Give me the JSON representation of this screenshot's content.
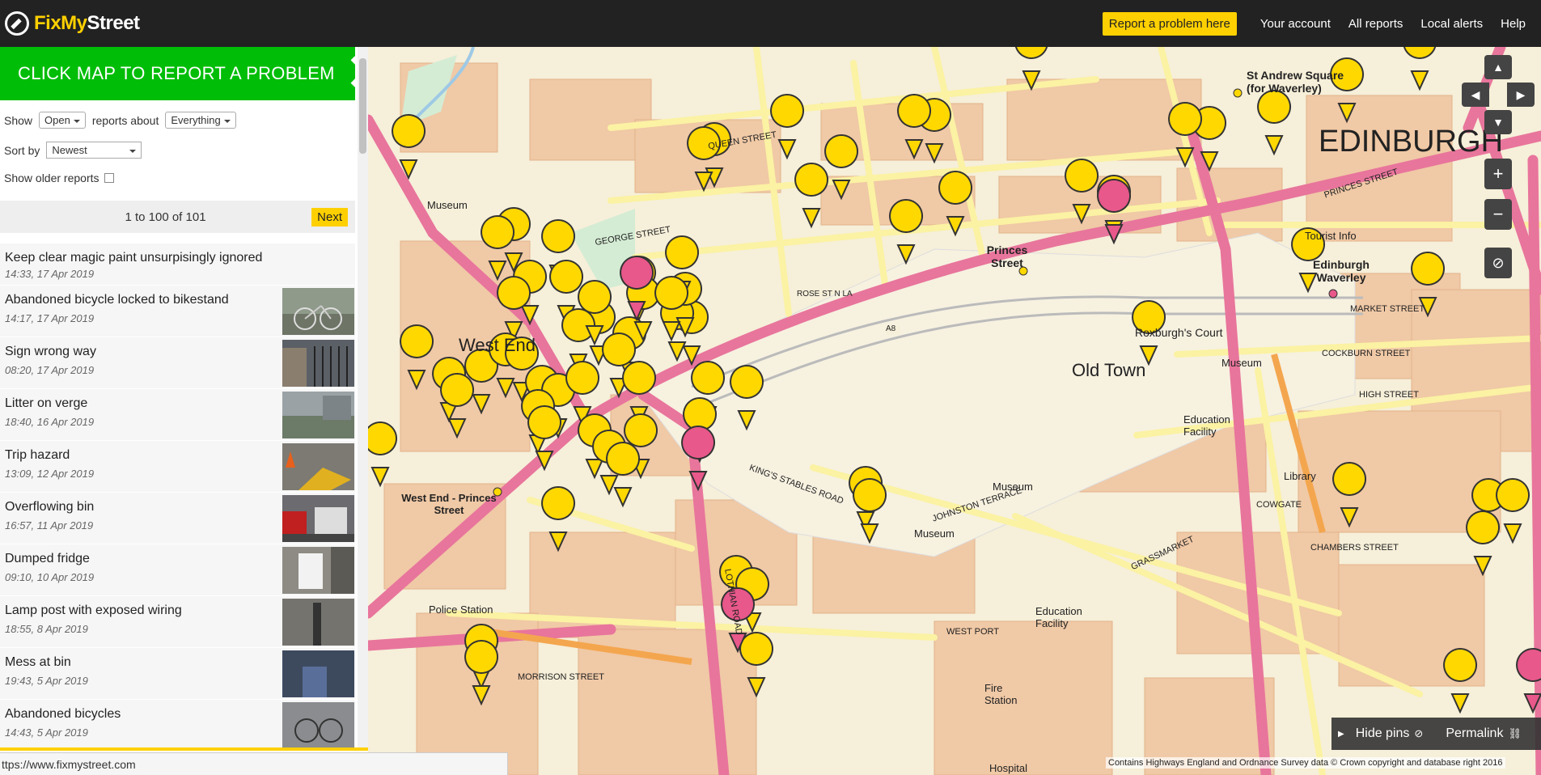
{
  "header": {
    "logo_part1": "FixMy",
    "logo_part2": "Street",
    "report_button": "Report a problem here",
    "nav": [
      "Your account",
      "All reports",
      "Local alerts",
      "Help"
    ]
  },
  "sidebar": {
    "cta": "CLICK MAP TO REPORT A PROBLEM",
    "show_label": "Show",
    "status_value": "Open",
    "reports_about_label": "reports about",
    "category_value": "Everything",
    "sort_label": "Sort by",
    "sort_value": "Newest",
    "older_label": "Show older reports",
    "pager_text": "1 to 100 of 101",
    "next_label": "Next",
    "reports": [
      {
        "title": "Keep clear magic paint unsurpisingly ignored",
        "meta": "14:33, 17 Apr 2019",
        "has_photo": false
      },
      {
        "title": "Abandoned bicycle locked to bikestand",
        "meta": "14:17, 17 Apr 2019",
        "has_photo": true
      },
      {
        "title": "Sign wrong way",
        "meta": "08:20, 17 Apr 2019",
        "has_photo": true
      },
      {
        "title": "Litter on verge",
        "meta": "18:40, 16 Apr 2019",
        "has_photo": true
      },
      {
        "title": "Trip hazard",
        "meta": "13:09, 12 Apr 2019",
        "has_photo": true
      },
      {
        "title": "Overflowing bin",
        "meta": "16:57, 11 Apr 2019",
        "has_photo": true
      },
      {
        "title": "Dumped fridge",
        "meta": "09:10, 10 Apr 2019",
        "has_photo": true
      },
      {
        "title": "Lamp post with exposed wiring",
        "meta": "18:55, 8 Apr 2019",
        "has_photo": true
      },
      {
        "title": "Mess at bin",
        "meta": "19:43, 5 Apr 2019",
        "has_photo": true
      },
      {
        "title": "Abandoned bicycles",
        "meta": "14:43, 5 Apr 2019",
        "has_photo": true
      }
    ]
  },
  "status_url": "ttps://www.fixmystreet.com",
  "map": {
    "labels": {
      "west_end": "West End",
      "old_town": "Old Town",
      "edinburgh": "EDINBURGH",
      "princes_street": "Princes Street",
      "west_end_princes": "West End - Princes Street",
      "st_andrew": "St Andrew Square (for Waverley)",
      "edinburgh_waverley": "Edinburgh Waverley",
      "roxburgh": "Roxburgh's Court",
      "police": "Police Station",
      "museum": "Museum",
      "tourist_info": "Tourist Info",
      "library": "Library",
      "education": "Education Facility",
      "fire_station": "Fire Station",
      "hospital": "Hospital",
      "george_street": "GEORGE STREET",
      "queen_street": "QUEEN STREET",
      "princes_st_road": "PRINCES STREET",
      "lothian_road": "LOTHIAN ROAD",
      "kings_stables": "KING'S STABLES ROAD",
      "johnston_terrace": "JOHNSTON TERRACE",
      "cowgate": "COWGATE",
      "grassmarket": "GRASSMARKET",
      "west_port": "WEST PORT",
      "morrison_street": "MORRISON STREET",
      "market_street": "MARKET STREET",
      "cockburn_street": "COCKBURN STREET",
      "high_street": "HIGH STREET",
      "chambers_street": "CHAMBERS STREET",
      "rose_st": "ROSE ST N LA",
      "a8": "A8"
    },
    "controls": {
      "zoom_in": "+",
      "zoom_out": "−"
    },
    "hide_pins": "Hide pins",
    "permalink": "Permalink",
    "attribution": "Contains Highways England and Ordnance Survey data © Crown copyright and database right 2016"
  }
}
